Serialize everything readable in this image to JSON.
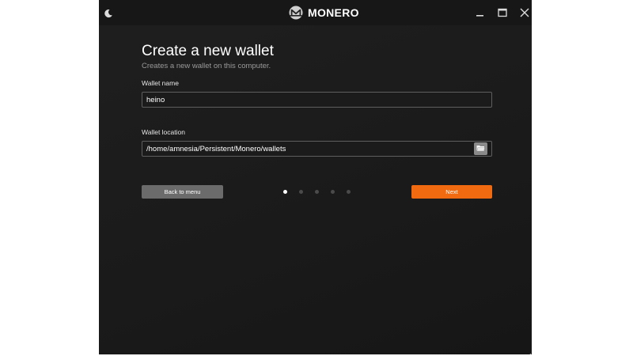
{
  "titlebar": {
    "app_name": "MONERO",
    "icons": {
      "theme": "moon-icon",
      "logo": "monero-logo-icon",
      "minimize": "minimize-icon",
      "maximize": "maximize-icon",
      "close": "close-icon"
    }
  },
  "page": {
    "title": "Create a new wallet",
    "subtitle": "Creates a new wallet on this computer."
  },
  "form": {
    "wallet_name": {
      "label": "Wallet name",
      "value": "heino"
    },
    "wallet_location": {
      "label": "Wallet location",
      "value": "/home/amnesia/Persistent/Monero/wallets",
      "browse_icon": "folder-open-icon"
    }
  },
  "navigation": {
    "back_label": "Back to menu",
    "next_label": "Next",
    "steps_total": 5,
    "current_step": 1
  },
  "colors": {
    "accent": "#f26a10",
    "background": "#1c1c1c",
    "secondary_button": "#6b6b6b"
  }
}
